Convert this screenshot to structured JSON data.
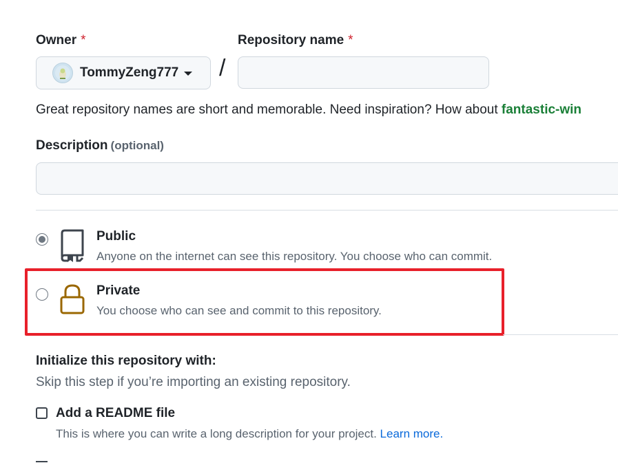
{
  "owner": {
    "label": "Owner",
    "required_mark": "*",
    "selected": "TommyZeng777"
  },
  "repo_name": {
    "label": "Repository name",
    "required_mark": "*",
    "value": "",
    "separator": "/"
  },
  "name_hint": {
    "text": "Great repository names are short and memorable. Need inspiration? How about ",
    "suggestion": "fantastic-win"
  },
  "description": {
    "label": "Description",
    "optional": "(optional)",
    "value": ""
  },
  "visibility": {
    "selected": "public",
    "options": [
      {
        "id": "public",
        "title": "Public",
        "desc": "Anyone on the internet can see this repository. You choose who can commit.",
        "icon": "repo-icon"
      },
      {
        "id": "private",
        "title": "Private",
        "desc": "You choose who can see and commit to this repository.",
        "icon": "lock-icon"
      }
    ]
  },
  "initialize": {
    "title": "Initialize this repository with:",
    "subtitle": "Skip this step if you’re importing an existing repository.",
    "readme": {
      "label": "Add a README file",
      "desc": "This is where you can write a long description for your project. ",
      "link": "Learn more.",
      "checked": false
    }
  },
  "colors": {
    "highlight": "#e8202a",
    "suggestion": "#1a7f37",
    "link": "#0969da",
    "lock_icon": "#9a6700"
  }
}
